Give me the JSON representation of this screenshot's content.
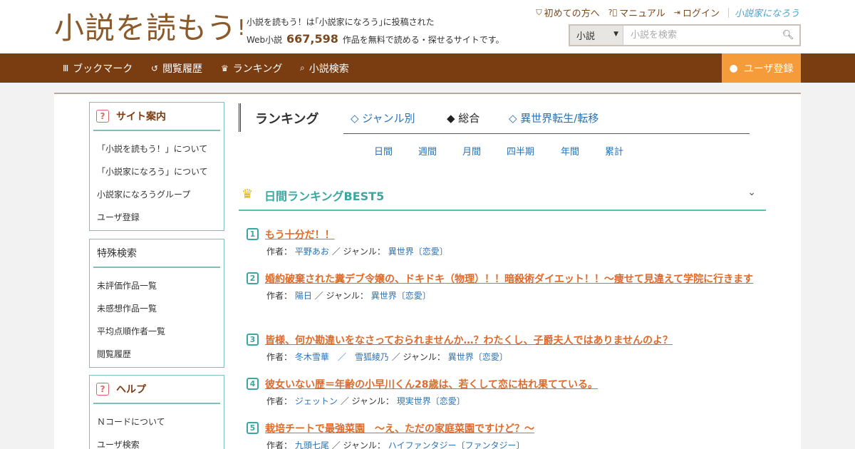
{
  "header": {
    "logo_main": "小説を読もう",
    "logo_bang": "!",
    "tagline_line1": "小説を読もう！は｢小説家になろう｣に投稿された",
    "tagline_pre": "Web小説",
    "tagline_count": "667,598",
    "tagline_post": "作品を無料で読める・探せるサイトです。",
    "links": [
      {
        "label": "初めての方へ",
        "icon": "shield-icon"
      },
      {
        "label": "マニュアル",
        "icon": "question-circle-icon"
      },
      {
        "label": "ログイン",
        "icon": "login-icon"
      }
    ],
    "narou_logo": "小説家になろう",
    "search": {
      "select_value": "小説",
      "placeholder": "小説を検索"
    }
  },
  "nav": {
    "items": [
      {
        "label": "ブックマーク",
        "icon": "bookmark-icon"
      },
      {
        "label": "閲覧履歴",
        "icon": "history-icon"
      },
      {
        "label": "ランキング",
        "icon": "crown-icon"
      },
      {
        "label": "小説検索",
        "icon": "search-icon"
      }
    ],
    "register": "ユーザ登録"
  },
  "sidebar": {
    "site_guide": {
      "title": "サイト案内",
      "links": [
        "「小説を読もう！」について",
        "「小説家になろう」について",
        "小説家になろうグループ",
        "ユーザ登録"
      ]
    },
    "special_search": {
      "title": "特殊検索",
      "links": [
        "未評価作品一覧",
        "未感想作品一覧",
        "平均点順作者一覧",
        "閲覧履歴"
      ]
    },
    "help": {
      "title": "ヘルプ",
      "links": [
        "Ｎコードについて",
        "ユーザ検索"
      ]
    }
  },
  "ranking": {
    "title": "ランキング",
    "tabs": [
      "◇ ジャンル別",
      "◆ 総合",
      "◇ 異世界転生/転移"
    ],
    "periods": [
      "日間",
      "週間",
      "月間",
      "四半期",
      "年間",
      "累計"
    ],
    "best_title": "日間ランキングBEST5",
    "author_label": "作者：",
    "genre_label": "／ ジャンル：",
    "items": [
      {
        "rank": "1",
        "title": "もう十分だ！！",
        "author": "平野あお",
        "genre": "異世界〔恋愛〕"
      },
      {
        "rank": "2",
        "title": "婚約破棄された糞デブ令嬢の、ドキドキ（物理）！！暗殺術ダイエット！！～痩せて見違えて学院に行きます",
        "author": "陽日",
        "genre": "異世界〔恋愛〕"
      },
      {
        "rank": "3",
        "title": "皆様、何か勘違いをなさっておられませんか…？わたくし、子爵夫人ではありませんのよ？",
        "author": "冬木雪華　／　雪狐綾乃",
        "genre": "異世界〔恋愛〕"
      },
      {
        "rank": "4",
        "title": "彼女いない歴＝年齢の小早川くん28歳は、若くして恋に枯れ果てている。",
        "author": "ジェットン",
        "genre": "現実世界〔恋愛〕"
      },
      {
        "rank": "5",
        "title": "栽培チートで最強菜園　～え、ただの家庭菜園ですけど？～",
        "author": "九頭七尾",
        "genre": "ハイファンタジー〔ファンタジー〕"
      }
    ]
  }
}
